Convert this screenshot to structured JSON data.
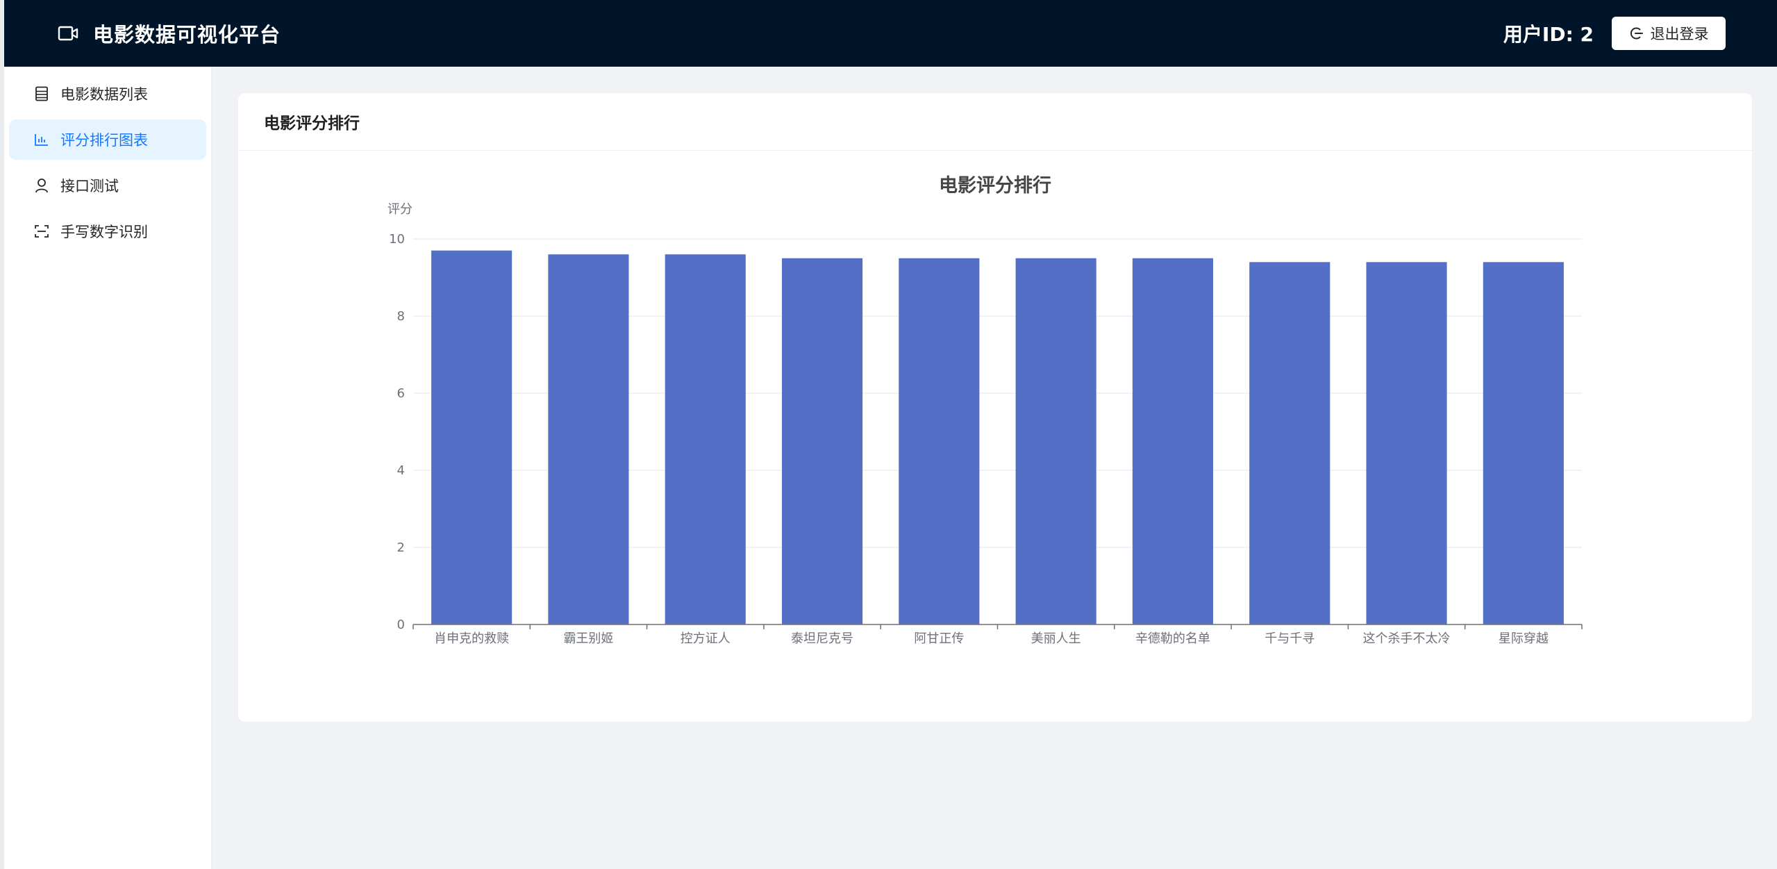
{
  "header": {
    "title": "电影数据可视化平台",
    "brand_icon": "video-camera-icon",
    "user_label": "用户ID: 2",
    "logout_label": "退出登录",
    "logout_icon": "logout-icon"
  },
  "sidebar": {
    "items": [
      {
        "label": "电影数据列表",
        "icon": "table-icon",
        "active": false
      },
      {
        "label": "评分排行图表",
        "icon": "bar-chart-icon",
        "active": true
      },
      {
        "label": "接口测试",
        "icon": "user-icon",
        "active": false
      },
      {
        "label": "手写数字识别",
        "icon": "scan-icon",
        "active": false
      }
    ]
  },
  "main": {
    "card_title": "电影评分排行"
  },
  "colors": {
    "header_bg": "#001529",
    "accent": "#1677ff",
    "active_bg": "#e6f4ff",
    "bar": "#5470c6"
  },
  "chart_data": {
    "type": "bar",
    "title": "电影评分排行",
    "ylabel": "评分",
    "xlabel": "",
    "ylim": [
      0,
      10
    ],
    "yticks": [
      0,
      2,
      4,
      6,
      8,
      10
    ],
    "grid": true,
    "categories": [
      "肖申克的救赎",
      "霸王别姬",
      "控方证人",
      "泰坦尼克号",
      "阿甘正传",
      "美丽人生",
      "辛德勒的名单",
      "千与千寻",
      "这个杀手不太冷",
      "星际穿越"
    ],
    "values": [
      9.7,
      9.6,
      9.6,
      9.5,
      9.5,
      9.5,
      9.5,
      9.4,
      9.4,
      9.4
    ]
  }
}
